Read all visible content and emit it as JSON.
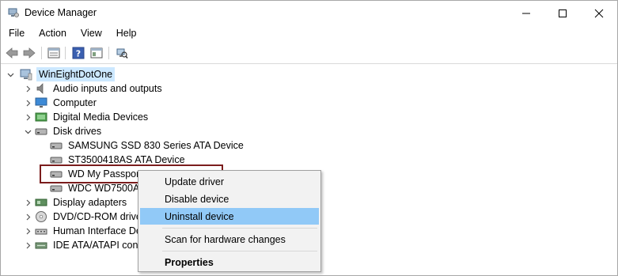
{
  "window": {
    "title": "Device Manager",
    "minimize_label": "—",
    "maximize_label": "☐",
    "close_label": "✕"
  },
  "menubar": {
    "items": [
      "File",
      "Action",
      "View",
      "Help"
    ]
  },
  "toolbar": {
    "buttons": [
      "back-icon",
      "forward-icon",
      "properties-icon",
      "help-icon",
      "show-hide-console-icon",
      "scan-hardware-icon"
    ]
  },
  "tree": {
    "root": "WinEightDotOne",
    "categories": [
      {
        "label": "Audio inputs and outputs",
        "icon": "speaker-icon",
        "expanded": false
      },
      {
        "label": "Computer",
        "icon": "monitor-icon",
        "expanded": false
      },
      {
        "label": "Digital Media Devices",
        "icon": "media-device-icon",
        "expanded": false
      },
      {
        "label": "Disk drives",
        "icon": "disk-drive-icon",
        "expanded": true
      },
      {
        "label": "Display adapters",
        "icon": "display-adapter-icon",
        "expanded": false
      },
      {
        "label": "DVD/CD-ROM drives",
        "icon": "dvd-icon",
        "expanded": false
      },
      {
        "label": "Human Interface Devices",
        "icon": "hid-icon",
        "expanded": false
      },
      {
        "label": "IDE ATA/ATAPI controllers",
        "icon": "ide-controller-icon",
        "expanded": false
      }
    ],
    "disk_children": [
      "SAMSUNG SSD 830 Series ATA Device",
      "ST3500418AS ATA Device",
      "WD My Passport",
      "WDC WD7500AZ"
    ]
  },
  "context_menu": {
    "items": [
      {
        "label": "Update driver",
        "highlighted": false,
        "bold": false
      },
      {
        "label": "Disable device",
        "highlighted": false,
        "bold": false
      },
      {
        "label": "Uninstall device",
        "highlighted": true,
        "bold": false
      },
      {
        "label": "Scan for hardware changes",
        "highlighted": false,
        "bold": false
      },
      {
        "label": "Properties",
        "highlighted": false,
        "bold": true
      }
    ]
  },
  "colors": {
    "selection_bg": "#cce8ff",
    "menu_highlight": "#91c9f7",
    "focus_border": "#7b1d1d"
  }
}
